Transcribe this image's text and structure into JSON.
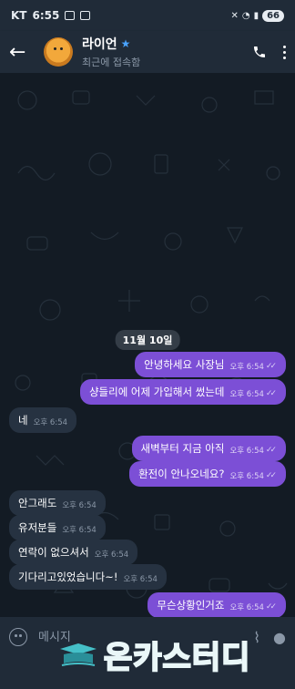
{
  "status_bar": {
    "carrier": "KT",
    "time": "6:55",
    "battery": "66"
  },
  "header": {
    "contact_name": "라이언",
    "subtitle": "최근에 접속함"
  },
  "date_chip": "11월 10일",
  "messages": [
    {
      "dir": "out",
      "text": "안녕하세요 사장님",
      "time": "오후 6:54",
      "read": true
    },
    {
      "dir": "out",
      "text": "샹들리에 어제 가입해서 썼는데",
      "time": "오후 6:54",
      "read": true
    },
    {
      "dir": "in",
      "text": "네",
      "time": "오후 6:54"
    },
    {
      "dir": "out",
      "text": "새벽부터 지금 아직",
      "time": "오후 6:54",
      "read": true
    },
    {
      "dir": "out",
      "text": "환전이 안나오네요?",
      "time": "오후 6:54",
      "read": true
    },
    {
      "dir": "in",
      "text": "안그래도",
      "time": "오후 6:54"
    },
    {
      "dir": "in",
      "text": "유저분들",
      "time": "오후 6:54"
    },
    {
      "dir": "in",
      "text": "연락이 없으셔서",
      "time": "오후 6:54"
    },
    {
      "dir": "in",
      "text": "기다리고있었습니다~!",
      "time": "오후 6:54"
    },
    {
      "dir": "out",
      "text": "무슨상황인거죠",
      "time": "오후 6:54",
      "read": true
    }
  ],
  "input": {
    "placeholder": "메시지"
  },
  "watermark": {
    "text": "온카스터디"
  },
  "colors": {
    "outgoing_bubble": "#7c4fd6",
    "incoming_bubble": "#263241",
    "background": "#131b24",
    "bar": "#202b38",
    "accent": "#4aa3ff"
  }
}
